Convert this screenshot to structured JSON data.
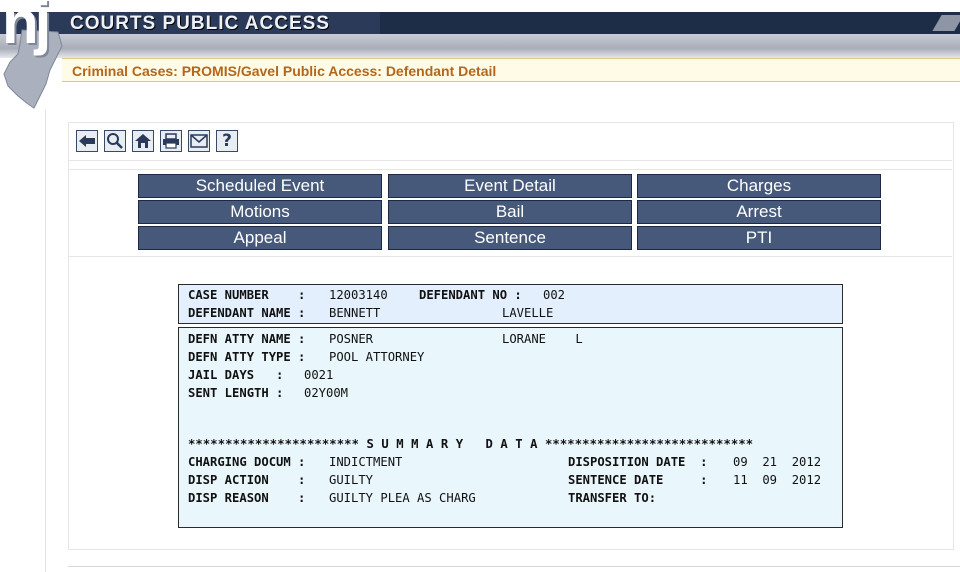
{
  "header": {
    "logo_text": "nj",
    "title": "COURTS PUBLIC ACCESS"
  },
  "breadcrumb": "Criminal Cases: PROMIS/Gavel Public Access: Defendant Detail",
  "toolbar": [
    {
      "icon": "back-arrow-icon",
      "glyph": "🡄"
    },
    {
      "icon": "search-icon",
      "glyph": "⌕"
    },
    {
      "icon": "home-icon",
      "glyph": "⌂"
    },
    {
      "icon": "print-icon",
      "glyph": "⎙"
    },
    {
      "icon": "email-icon",
      "glyph": "✉"
    },
    {
      "icon": "help-icon",
      "glyph": "?"
    }
  ],
  "nav": {
    "scheduled_event": "Scheduled Event",
    "event_detail": "Event Detail",
    "charges": "Charges",
    "motions": "Motions",
    "bail": "Bail",
    "arrest": "Arrest",
    "appeal": "Appeal",
    "sentence": "Sentence",
    "pti": "PTI"
  },
  "case": {
    "case_number_label": "CASE NUMBER    :",
    "case_number": "12003140",
    "defendant_no_label": "DEFENDANT NO :",
    "defendant_no": "002",
    "defendant_name_label": "DEFENDANT NAME :",
    "defendant_last": "BENNETT",
    "defendant_first": "LAVELLE"
  },
  "detail": {
    "defn_atty_name_label": "DEFN ATTY NAME :",
    "defn_atty_last": "POSNER",
    "defn_atty_first": "LORANE    L",
    "defn_atty_type_label": "DEFN ATTY TYPE :",
    "defn_atty_type": "POOL ATTORNEY",
    "jail_days_label": "JAIL DAYS   :",
    "jail_days": "0021",
    "sent_length_label": "SENT LENGTH :",
    "sent_length": "02Y00M",
    "summary_header": "*********************** S U M M A R Y   D A T A ****************************",
    "charging_docum_label": "CHARGING DOCUM :",
    "charging_docum": "INDICTMENT",
    "disposition_date_label": "DISPOSITION DATE  :",
    "disposition_date": "09  21  2012",
    "disp_action_label": "DISP ACTION    :",
    "disp_action": "GUILTY",
    "sentence_date_label": "SENTENCE DATE     :",
    "sentence_date": "11  09  2012",
    "disp_reason_label": "DISP REASON    :",
    "disp_reason": "GUILTY PLEA AS CHARG",
    "transfer_to_label": "TRANSFER TO:"
  }
}
